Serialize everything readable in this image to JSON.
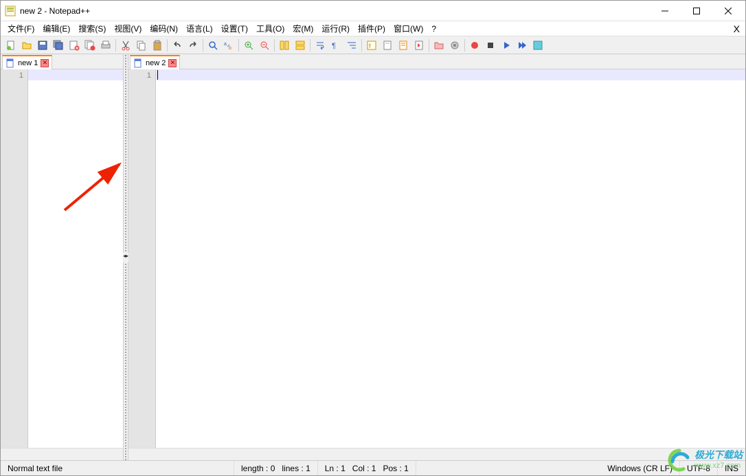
{
  "title": "new 2 - Notepad++",
  "menubar": {
    "items": [
      "文件(F)",
      "编辑(E)",
      "搜索(S)",
      "视图(V)",
      "编码(N)",
      "语言(L)",
      "设置(T)",
      "工具(O)",
      "宏(M)",
      "运行(R)",
      "插件(P)",
      "窗口(W)",
      "?"
    ],
    "close_doc": "X"
  },
  "toolbar_icons": [
    "new-file-icon",
    "open-file-icon",
    "save-icon",
    "save-all-icon",
    "close-file-icon",
    "close-all-icon",
    "print-icon",
    "sep",
    "cut-icon",
    "copy-icon",
    "paste-icon",
    "sep",
    "undo-icon",
    "redo-icon",
    "sep",
    "find-icon",
    "replace-icon",
    "sep",
    "zoom-in-icon",
    "zoom-out-icon",
    "sep",
    "sync-v-icon",
    "sync-h-icon",
    "sep",
    "wrap-icon",
    "all-chars-icon",
    "indent-guides-icon",
    "sep",
    "lang-icon",
    "doc-map-icon",
    "doc-list-icon",
    "func-list-icon",
    "sep",
    "folder-icon",
    "monitor-icon",
    "sep",
    "record-icon",
    "stop-icon",
    "play-icon",
    "play-multi-icon",
    "save-macro-icon"
  ],
  "panes": {
    "left": {
      "tab": {
        "name": "new 1",
        "line_number": "1"
      }
    },
    "right": {
      "tab": {
        "name": "new 2",
        "line_number": "1"
      }
    }
  },
  "status": {
    "file_type": "Normal text file",
    "length_label": "length : 0",
    "lines_label": "lines : 1",
    "ln_label": "Ln : 1",
    "col_label": "Col : 1",
    "pos_label": "Pos : 1",
    "eol": "Windows (CR LF)",
    "encoding": "UTF-8",
    "mode": "INS"
  },
  "watermark": {
    "title": "极光下载站",
    "url": "www.xz7.com"
  }
}
